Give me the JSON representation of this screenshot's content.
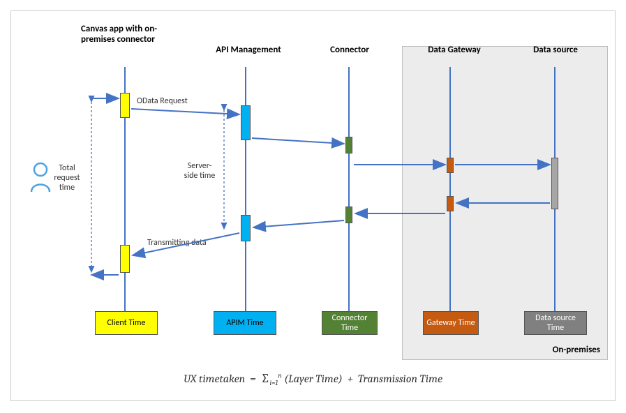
{
  "headers": {
    "canvas_app": "Canvas app with on-premises connector",
    "api_mgmt": "API Management",
    "connector": "Connector",
    "data_gateway": "Data Gateway",
    "data_source": "Data source"
  },
  "annotations": {
    "odata_request": "OData Request",
    "server_side": "Server-side time",
    "transmitting": "Transmitting data",
    "total_request": "Total request time",
    "on_premises": "On-premises"
  },
  "time_boxes": {
    "client": "Client Time",
    "apim": "APIM Time",
    "connector": "Connector Time",
    "gateway": "Gateway Time",
    "datasource": "Data source Time"
  },
  "formula": {
    "lhs": "UX timetaken",
    "rhs_layer": "(Layer Time)",
    "rhs_tx": "Transmission Time",
    "sum_lower": "i=1",
    "sum_upper": "n"
  }
}
